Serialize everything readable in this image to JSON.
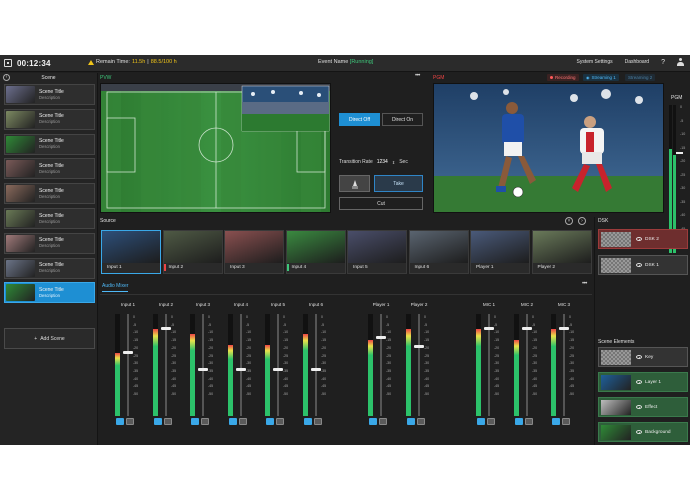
{
  "topbar": {
    "clock": "00:12:34",
    "remain_prefix": "Remain Time:",
    "remain_time": "11.5h",
    "remain_sep": "|",
    "remain_quota": "88.5/100 h",
    "event_label": "Event Name",
    "event_status": "[Running]",
    "system_settings": "System Settings",
    "dashboard": "Dashboard",
    "help": "?"
  },
  "scene_panel": {
    "title": "Scene",
    "items": [
      {
        "title": "Scene Title",
        "desc": "Description",
        "thumb": "#6c6f8e"
      },
      {
        "title": "Scene Title",
        "desc": "Description",
        "thumb": "#7d8a62"
      },
      {
        "title": "Scene Title",
        "desc": "Description",
        "thumb": "#2f8a37"
      },
      {
        "title": "Scene Title",
        "desc": "Description",
        "thumb": "#7a5a58"
      },
      {
        "title": "Scene Title",
        "desc": "Description",
        "thumb": "#8a6a5c"
      },
      {
        "title": "Scene Title",
        "desc": "Description",
        "thumb": "#6a7a56"
      },
      {
        "title": "Scene Title",
        "desc": "Description",
        "thumb": "#a07a7a"
      },
      {
        "title": "Scene Title",
        "desc": "Description",
        "thumb": "#6b7488"
      },
      {
        "title": "Scene Title",
        "desc": "Description",
        "thumb": "#2f8a37"
      }
    ],
    "active_index": 8,
    "add_label": "Add Scene"
  },
  "preview": {
    "label": "PVW"
  },
  "program": {
    "label": "PGM"
  },
  "status": {
    "recording": "Recording",
    "streaming1": "Streaming 1",
    "streaming2": "Streaming 2"
  },
  "transition": {
    "direct_off": "Direct Off",
    "direct_on": "Direct On",
    "rate_label": "Transition Rate",
    "rate_value": "1234",
    "rate_unit": "Sec",
    "take": "Take",
    "cut": "Cut"
  },
  "pgm_meter": {
    "label": "PGM",
    "scale": [
      "0",
      "-5",
      "-10",
      "-15",
      "-20",
      "-25",
      "-30",
      "-35",
      "-40",
      "-45",
      "-50"
    ],
    "level": 0.7
  },
  "source": {
    "label": "Source",
    "items": [
      {
        "name": "Input 1",
        "color": "#2d4f7a",
        "mark": ""
      },
      {
        "name": "Input 2",
        "color": "#4f5a45",
        "mark": "#e44"
      },
      {
        "name": "Input 3",
        "color": "#8a5050",
        "mark": ""
      },
      {
        "name": "Input 4",
        "color": "#3a8a40",
        "mark": "#3ec77a"
      },
      {
        "name": "Input 5",
        "color": "#4a4e6a",
        "mark": ""
      },
      {
        "name": "Input 6",
        "color": "#5a6470",
        "mark": ""
      },
      {
        "name": "Player 1",
        "color": "#4a5a7a",
        "mark": ""
      },
      {
        "name": "Player 2",
        "color": "#6a7a5a",
        "mark": ""
      }
    ]
  },
  "audio_mixer": {
    "tab": "Audio Mixer",
    "scale": [
      "0",
      "-5",
      "-10",
      "-15",
      "-20",
      "-25",
      "-30",
      "-35",
      "-40",
      "-45",
      "-50"
    ],
    "channels": [
      {
        "name": "Input 1",
        "level": 0.62,
        "fader": 0.36
      },
      {
        "name": "Input 2",
        "level": 0.85,
        "fader": 0.13
      },
      {
        "name": "Input 3",
        "level": 0.8,
        "fader": 0.53
      },
      {
        "name": "Input 4",
        "level": 0.7,
        "fader": 0.53
      },
      {
        "name": "Input 5",
        "level": 0.7,
        "fader": 0.53
      },
      {
        "name": "Input 6",
        "level": 0.8,
        "fader": 0.53
      },
      {
        "name": "Player 1",
        "level": 0.75,
        "fader": 0.22
      },
      {
        "name": "Player 2",
        "level": 0.85,
        "fader": 0.3
      },
      {
        "name": "MIC 1",
        "level": 0.85,
        "fader": 0.13
      },
      {
        "name": "MIC 2",
        "level": 0.75,
        "fader": 0.13
      },
      {
        "name": "MIC 3",
        "level": 0.85,
        "fader": 0.13
      }
    ]
  },
  "dsk": {
    "label": "DSK",
    "items": [
      {
        "name": "DSK 2",
        "style": "red"
      },
      {
        "name": "DSK 1",
        "style": "grey"
      }
    ],
    "scene_elements_label": "Scene Elements",
    "elements": [
      {
        "name": "Key",
        "style": "grey"
      },
      {
        "name": "Layer 1",
        "style": "green"
      },
      {
        "name": "Effect",
        "style": "green"
      },
      {
        "name": "Background",
        "style": "green"
      }
    ]
  }
}
